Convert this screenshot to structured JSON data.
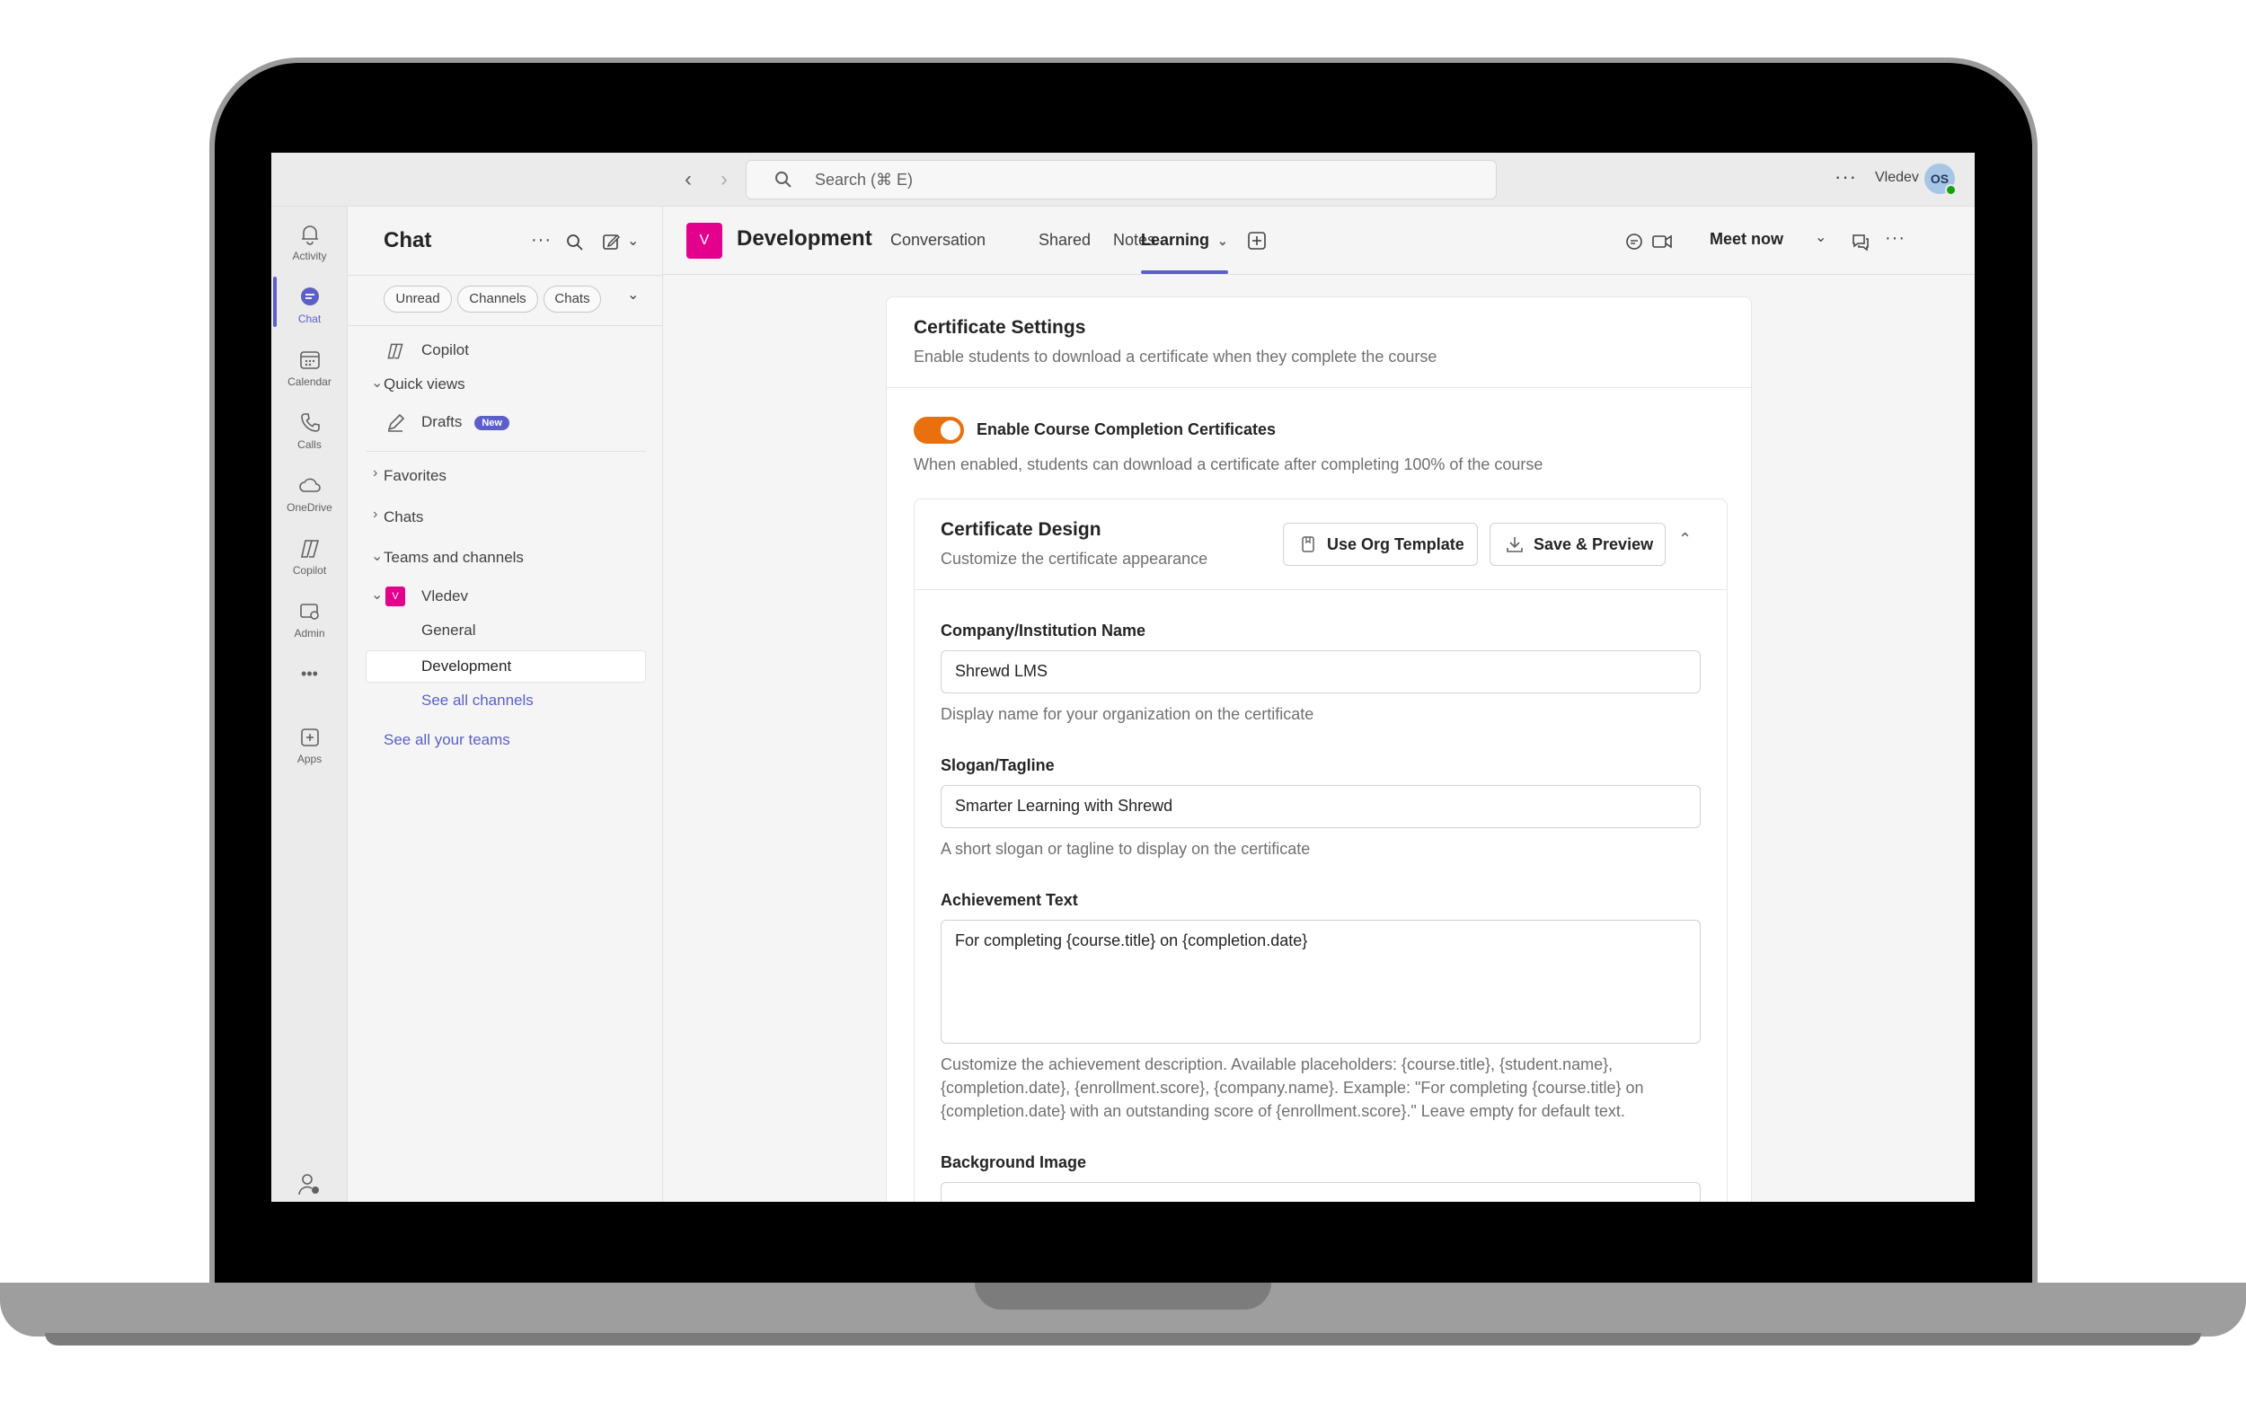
{
  "titlebar": {
    "search_placeholder": "Search (⌘ E)",
    "more": "···",
    "user_name": "Vledev",
    "avatar_initials": "OS"
  },
  "rail": {
    "items": [
      {
        "label": "Activity",
        "icon": "bell-icon"
      },
      {
        "label": "Chat",
        "icon": "chat-icon"
      },
      {
        "label": "Calendar",
        "icon": "calendar-icon"
      },
      {
        "label": "Calls",
        "icon": "phone-icon"
      },
      {
        "label": "OneDrive",
        "icon": "cloud-icon"
      },
      {
        "label": "Copilot",
        "icon": "copilot-icon"
      },
      {
        "label": "Admin",
        "icon": "admin-icon"
      },
      {
        "label": "Apps",
        "icon": "apps-icon"
      }
    ],
    "more": "•••"
  },
  "chat_panel": {
    "title": "Chat",
    "filters": [
      "Unread",
      "Channels",
      "Chats"
    ],
    "copilot": "Copilot",
    "quick_views": "Quick views",
    "drafts": "Drafts",
    "drafts_badge": "New",
    "favorites": "Favorites",
    "chats": "Chats",
    "teams_and_channels": "Teams and channels",
    "team_name": "Vledev",
    "team_initial": "V",
    "channels": [
      "General",
      "Development"
    ],
    "see_all_channels": "See all channels",
    "see_all_teams": "See all your teams"
  },
  "channel_header": {
    "avatar_initial": "V",
    "title": "Development",
    "tabs": [
      "Conversation",
      "Shared",
      "Notes",
      "Learning"
    ],
    "active_tab": "Learning",
    "meet_now": "Meet now"
  },
  "certificate": {
    "title": "Certificate Settings",
    "subtitle": "Enable students to download a certificate when they complete the course",
    "toggle_label": "Enable Course Completion Certificates",
    "toggle_on": true,
    "toggle_help": "When enabled, students can download a certificate after completing 100% of the course",
    "accent_color": "#e8700f",
    "design": {
      "title": "Certificate Design",
      "subtitle": "Customize the certificate appearance",
      "use_org_template": "Use Org Template",
      "save_preview": "Save & Preview",
      "fields": {
        "company_label": "Company/Institution Name",
        "company_value": "Shrewd LMS",
        "company_help": "Display name for your organization on the certificate",
        "slogan_label": "Slogan/Tagline",
        "slogan_value": "Smarter Learning with Shrewd",
        "slogan_help": "A short slogan or tagline to display on the certificate",
        "achievement_label": "Achievement Text",
        "achievement_value": "For completing {course.title} on {completion.date}",
        "achievement_help": "Customize the achievement description. Available placeholders: {course.title}, {student.name}, {completion.date}, {enrollment.score}, {company.name}. Example: \"For completing {course.title} on {completion.date} with an outstanding score of {enrollment.score}.\" Leave empty for default text.",
        "background_label": "Background Image"
      }
    }
  }
}
